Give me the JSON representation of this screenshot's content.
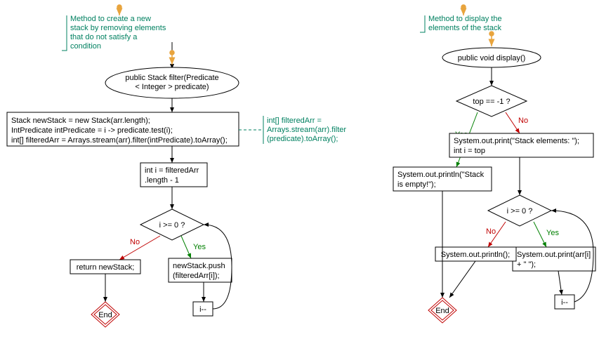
{
  "left": {
    "comment_lines": [
      "Method to create a new",
      "stack by removing elements",
      "that do not satisfy a",
      "condition"
    ],
    "signature_lines": [
      "public Stack filter(Predicate",
      "< Integer > predicate)"
    ],
    "init_block_lines": [
      "Stack newStack = new Stack(arr.length);",
      "IntPredicate intPredicate = i -> predicate.test(i);",
      "int[] filteredArr = Arrays.stream(arr).filter(intPredicate).toArray();"
    ],
    "side_comment_lines": [
      "int[] filteredArr =",
      "Arrays.stream(arr).filter",
      "(predicate).toArray();"
    ],
    "init_i_lines": [
      "int i = filteredArr",
      ".length - 1"
    ],
    "condition": "i >= 0 ?",
    "yes": "Yes",
    "no": "No",
    "push_lines": [
      "newStack.push",
      "(filteredArr[i]);"
    ],
    "decrement_label": "i--",
    "return_label": "return newStack;",
    "end_label": "End"
  },
  "right": {
    "comment_lines": [
      "Method to display the",
      "elements of the stack"
    ],
    "signature": "public void display()",
    "condition_top": "top == -1 ?",
    "yes": "Yes",
    "no": "No",
    "empty_lines": [
      "System.out.println(\"Stack",
      "is empty!\");"
    ],
    "header_lines": [
      "System.out.print(\"Stack elements: \");",
      "int i = top"
    ],
    "condition_i": "i >= 0 ?",
    "print_lines": [
      "System.out.print(arr[i]",
      "+ \" \");"
    ],
    "println_label": "System.out.println();",
    "decrement_label": "i--",
    "end_label": "End"
  }
}
